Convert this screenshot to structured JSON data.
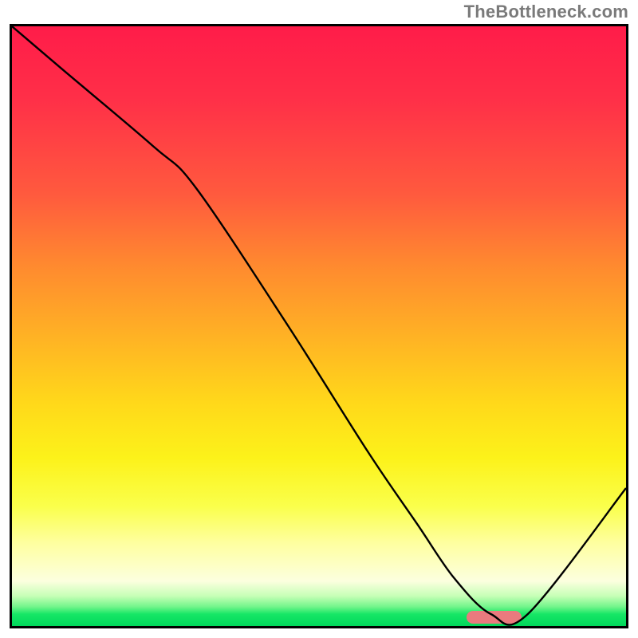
{
  "watermark": "TheBottleneck.com",
  "chart_data": {
    "type": "line",
    "title": "",
    "xlabel": "",
    "ylabel": "",
    "xlim": [
      0,
      100
    ],
    "ylim": [
      0,
      100
    ],
    "series": [
      {
        "name": "bottleneck-curve",
        "x": [
          0,
          8,
          23,
          30,
          45,
          58,
          66,
          72,
          78,
          84,
          100
        ],
        "y": [
          100,
          93,
          80,
          73,
          50,
          29,
          17,
          8,
          2,
          2,
          23
        ]
      }
    ],
    "annotations": [
      {
        "name": "optimal-region-marker",
        "x_range": [
          74,
          83
        ],
        "y": 1.5
      }
    ],
    "background_gradient_stops": [
      {
        "pct": 0,
        "color": "#ff1c49"
      },
      {
        "pct": 12,
        "color": "#ff2f48"
      },
      {
        "pct": 28,
        "color": "#ff5a3e"
      },
      {
        "pct": 40,
        "color": "#ff8a2f"
      },
      {
        "pct": 52,
        "color": "#ffb324"
      },
      {
        "pct": 63,
        "color": "#ffd91a"
      },
      {
        "pct": 72,
        "color": "#fcf21a"
      },
      {
        "pct": 80,
        "color": "#faff4b"
      },
      {
        "pct": 86,
        "color": "#feff9e"
      },
      {
        "pct": 92.5,
        "color": "#fcffdf"
      },
      {
        "pct": 95,
        "color": "#c6ffb6"
      },
      {
        "pct": 96.8,
        "color": "#71f58a"
      },
      {
        "pct": 98,
        "color": "#17e766"
      },
      {
        "pct": 100,
        "color": "#00d85b"
      }
    ]
  }
}
